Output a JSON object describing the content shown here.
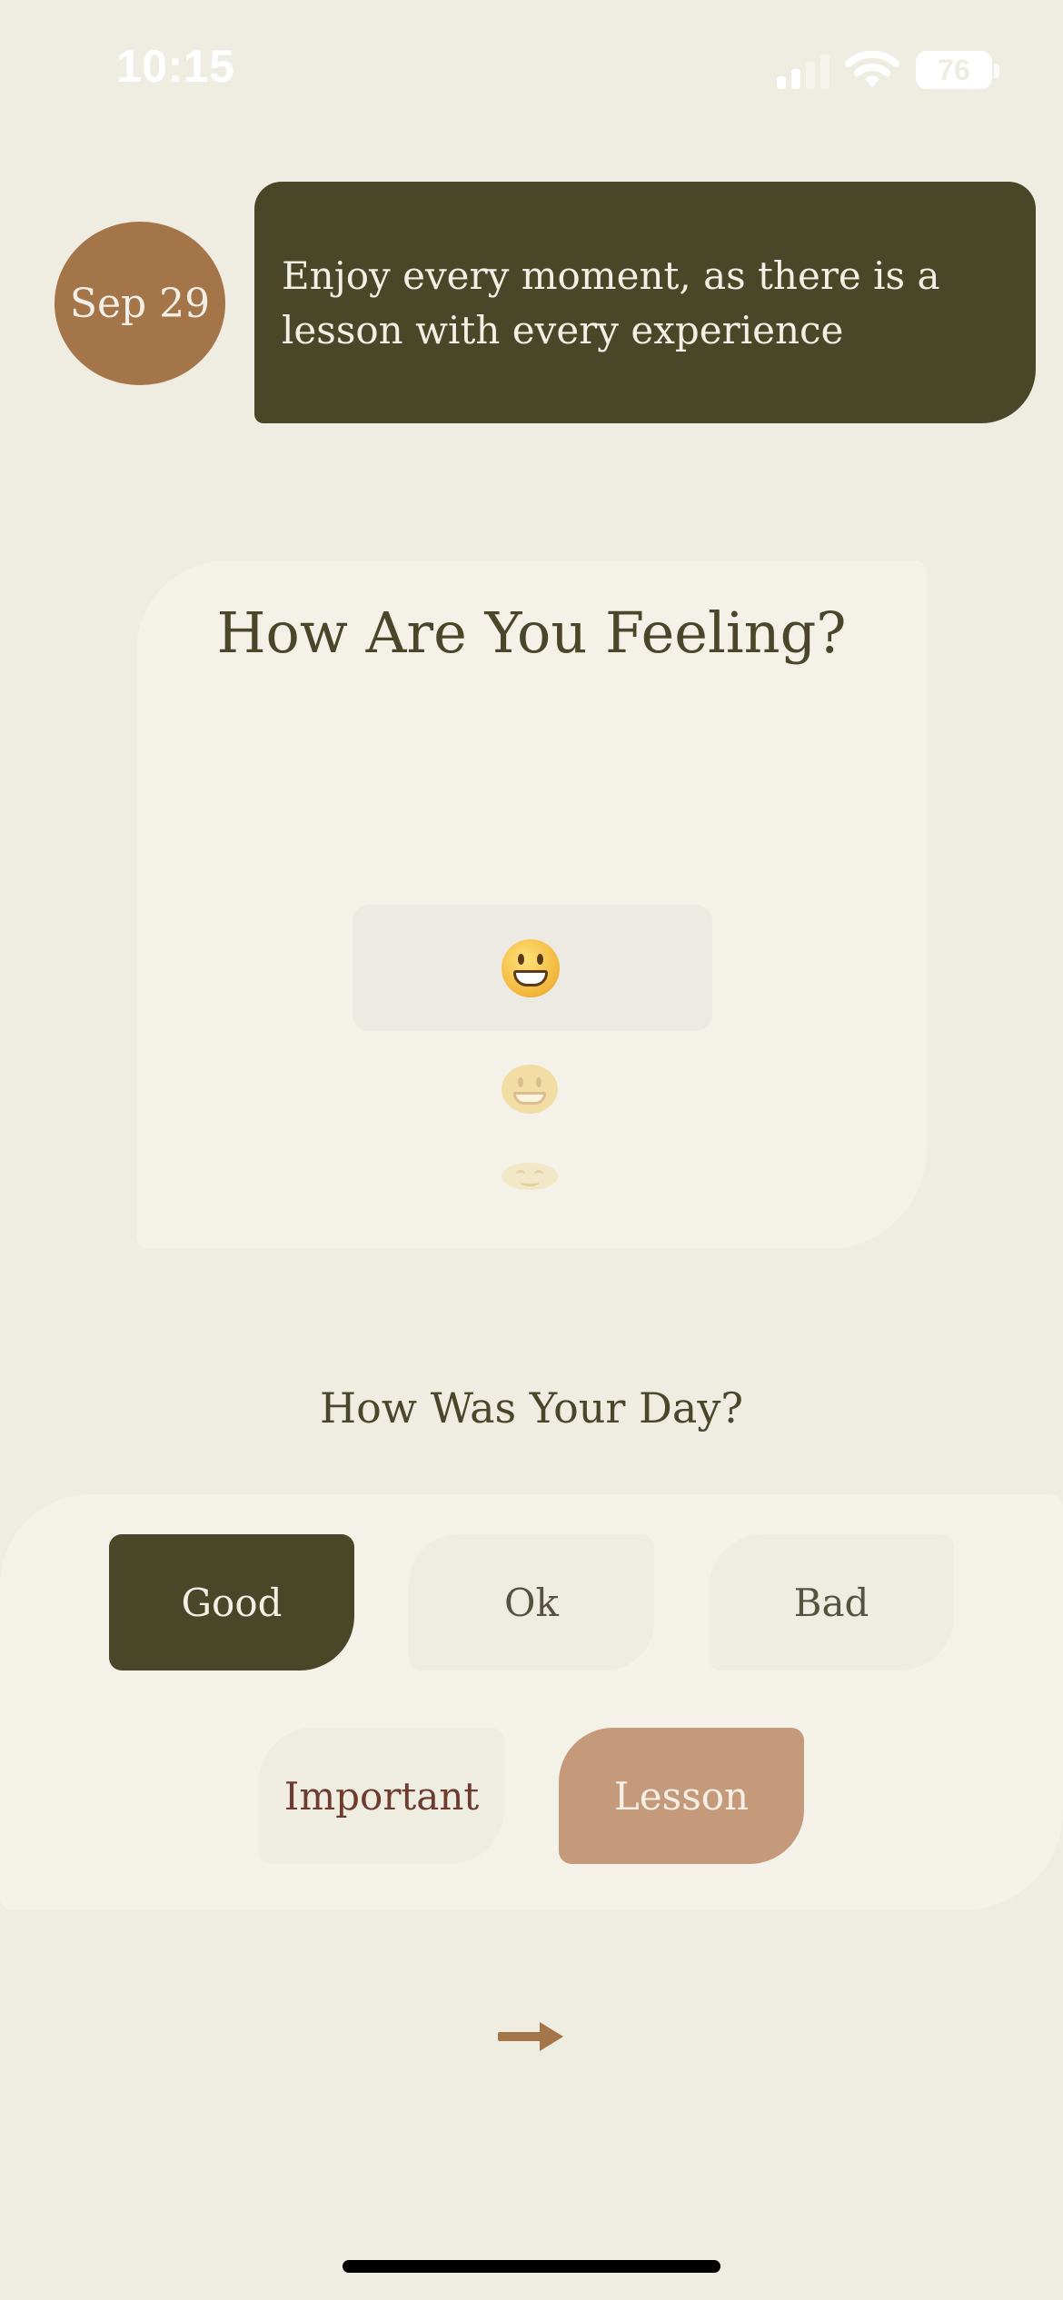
{
  "status_bar": {
    "time": "10:15",
    "battery": "76"
  },
  "header": {
    "date": "Sep 29",
    "quote": "Enjoy every moment, as there is a lesson with every experience"
  },
  "feeling": {
    "title": "How Are You Feeling?",
    "moods": [
      {
        "icon": "grinning-face-icon",
        "state": "selected"
      },
      {
        "icon": "smiling-face-icon",
        "state": "faded"
      },
      {
        "icon": "smiling-eyes-face-icon",
        "state": "more-faded"
      }
    ]
  },
  "day": {
    "title": "How Was Your Day?",
    "options": [
      {
        "label": "Good",
        "selected": true
      },
      {
        "label": "Ok",
        "selected": false
      },
      {
        "label": "Bad",
        "selected": false
      },
      {
        "label": "Important",
        "selected": false
      },
      {
        "label": "Lesson",
        "selected": true
      }
    ]
  },
  "navigation": {
    "next_icon": "arrow-right-icon"
  },
  "colors": {
    "background": "#EFECE1",
    "card": "#F4F1E9",
    "dark_olive": "#4A4628",
    "date_badge": "#A47548",
    "lesson_chip": "#C49A7B",
    "important_text": "#6E3B2F"
  }
}
